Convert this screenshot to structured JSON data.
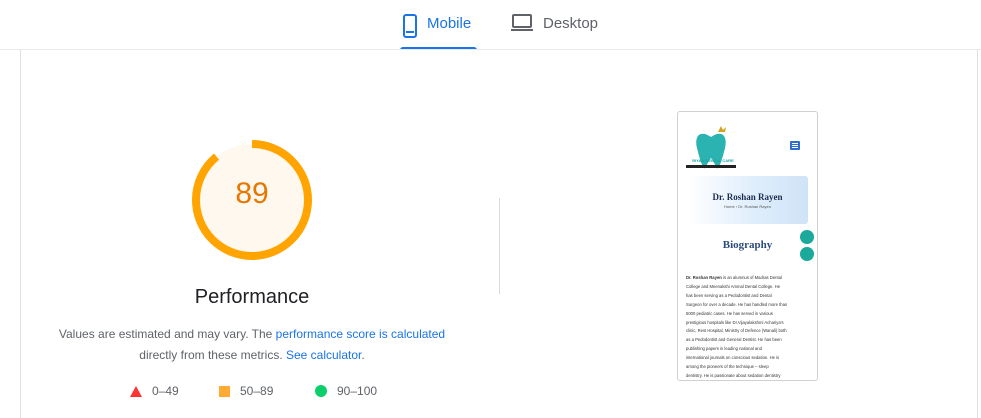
{
  "tabs": {
    "mobile": {
      "label": "Mobile",
      "icon": "smartphone-icon",
      "active": true
    },
    "desktop": {
      "label": "Desktop",
      "icon": "laptop-icon",
      "active": false
    }
  },
  "gauge": {
    "score": "89",
    "fraction": 0.89,
    "title": "Performance",
    "ring_color": "#ffa400",
    "fill_color": "#fff8ee",
    "text_color": "#e67700"
  },
  "description": {
    "text_1": "Values are estimated and may vary. The ",
    "link_1": "performance score is calculated",
    "text_2": "directly from these metrics. ",
    "link_2": "See calculator",
    "text_3": "."
  },
  "legend": [
    {
      "shape": "triangle",
      "color": "#ff3333",
      "label": "0–49"
    },
    {
      "shape": "square",
      "color": "#ffaa33",
      "label": "50–89"
    },
    {
      "shape": "circle",
      "color": "#0cce6b",
      "label": "90–100"
    }
  ],
  "preview": {
    "logo_text": "RIYAN DENTAL CARE",
    "doctor_name": "Dr. Roshan Rayen",
    "breadcrumb": "Home › Dr. Roshan Rayen",
    "section_title": "Biography",
    "bio_lead": "Dr. Roshan Rayen",
    "bio_lines": [
      " is an alumnus of Madras Dental",
      "College and Meenakshi Ammal Dental College. He",
      "has been serving as a Pedodontist and Dental",
      "Surgeon for over a decade. He has handled more than",
      "5000 pediatric cases. He has served in various",
      "prestigious hospitals like Dr.Vijayalakshmi Achariya's",
      "clinic, Rest Hospital, Ministry of Defence (Wanali) both",
      "as a Pedodontist and General Dentist. He has been",
      "publishing papers in leading national and",
      "international journals on conscious sedation. He is",
      "among the pioneers of the technique – sleep",
      "dentistry. He is passionate about sedation dentistry"
    ]
  }
}
